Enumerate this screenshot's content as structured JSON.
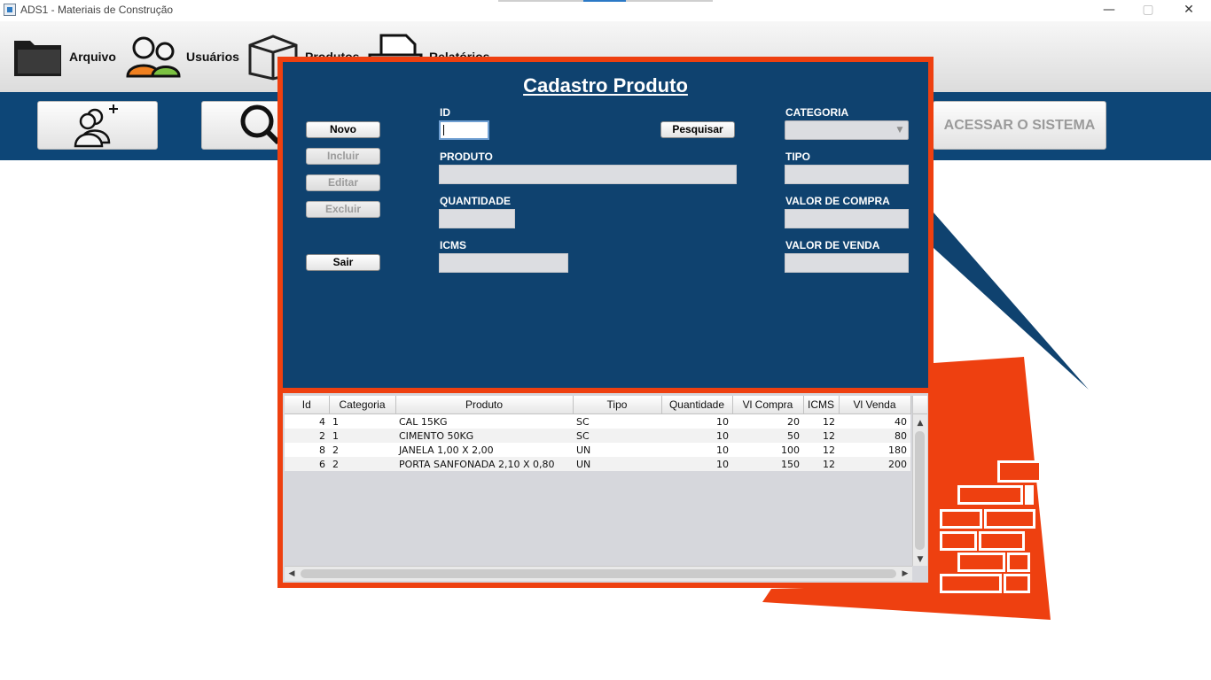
{
  "window": {
    "title": "ADS1 - Materiais de Construção",
    "minimize": "—",
    "maximize": "▢",
    "close": "✕"
  },
  "menu": {
    "items": [
      {
        "label": "Arquivo",
        "icon": "folder-icon"
      },
      {
        "label": "Usuários",
        "icon": "users-icon"
      },
      {
        "label": "Produtos",
        "icon": "box-icon"
      },
      {
        "label": "Relatórios",
        "icon": "printer-icon"
      }
    ]
  },
  "toolbar": {
    "add_user_icon": "add-user-icon",
    "search_icon": "search-icon",
    "access_label": "ACESSAR O SISTEMA"
  },
  "form": {
    "title": "Cadastro Produto",
    "buttons": {
      "novo": "Novo",
      "incluir": "Incluir",
      "editar": "Editar",
      "excluir": "Excluir",
      "sair": "Sair",
      "pesquisar": "Pesquisar"
    },
    "labels": {
      "id": "ID",
      "produto": "PRODUTO",
      "quantidade": "QUANTIDADE",
      "icms": "ICMS",
      "categoria": "CATEGORIA",
      "tipo": "TIPO",
      "valor_compra": "VALOR DE COMPRA",
      "valor_venda": "VALOR DE VENDA"
    },
    "values": {
      "id": "",
      "produto": "",
      "quantidade": "",
      "icms": "",
      "categoria": "",
      "tipo": "",
      "valor_compra": "",
      "valor_venda": ""
    }
  },
  "table": {
    "columns": [
      "Id",
      "Categoria",
      "Produto",
      "Tipo",
      "Quantidade",
      "Vl Compra",
      "ICMS",
      "Vl Venda"
    ],
    "rows": [
      [
        "4",
        "1",
        "CAL 15KG",
        "SC",
        "10",
        "20",
        "12",
        "40"
      ],
      [
        "2",
        "1",
        "CIMENTO 50KG",
        "SC",
        "10",
        "50",
        "12",
        "80"
      ],
      [
        "8",
        "2",
        "JANELA 1,00 X 2,00",
        "UN",
        "10",
        "100",
        "12",
        "180"
      ],
      [
        "6",
        "2",
        "PORTA SANFONADA 2,10 X 0,80",
        "UN",
        "10",
        "150",
        "12",
        "200"
      ]
    ]
  },
  "colors": {
    "brand_blue": "#0f426f",
    "brand_orange": "#ee4010"
  }
}
